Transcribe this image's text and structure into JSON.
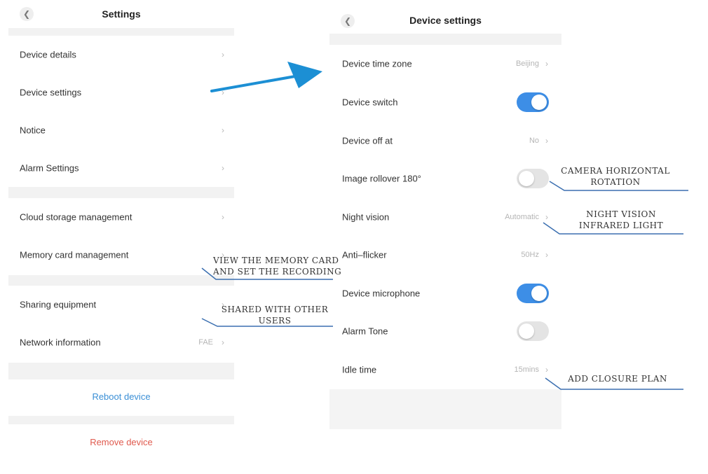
{
  "settings": {
    "title": "Settings",
    "items": [
      {
        "label": "Device details",
        "value": ""
      },
      {
        "label": "Device settings",
        "value": ""
      },
      {
        "label": "Notice",
        "value": ""
      },
      {
        "label": "Alarm Settings",
        "value": ""
      },
      {
        "label": "Cloud storage management",
        "value": ""
      },
      {
        "label": "Memory card management",
        "value": ""
      },
      {
        "label": "Sharing equipment",
        "value": ""
      },
      {
        "label": "Network information",
        "value": "FAE"
      }
    ],
    "reboot_label": "Reboot device",
    "remove_label": "Remove device"
  },
  "device_settings": {
    "title": "Device settings",
    "items": [
      {
        "label": "Device time zone",
        "value": "Beijing"
      },
      {
        "label": "Device switch",
        "toggle": true
      },
      {
        "label": "Device off at",
        "value": "No"
      },
      {
        "label": "Image rollover 180°",
        "toggle": false
      },
      {
        "label": "Night vision",
        "value": "Automatic"
      },
      {
        "label": "Anti–flicker",
        "value": "50Hz"
      },
      {
        "label": "Device microphone",
        "toggle": true
      },
      {
        "label": "Alarm Tone",
        "toggle": false
      },
      {
        "label": "Idle time",
        "value": "15mins"
      }
    ]
  },
  "annotations": {
    "memory_card": [
      "VIEW THE MEMORY CARD",
      "AND SET THE RECORDING"
    ],
    "sharing": [
      "SHARED WITH OTHER",
      "USERS"
    ],
    "rollover": [
      "CAMERA HORIZONTAL",
      "ROTATION"
    ],
    "night_vision": [
      "NIGHT VISION",
      "INFRARED LIGHT"
    ],
    "idle_time": [
      "ADD CLOSURE PLAN"
    ]
  },
  "icons": {
    "back": "chevron-left-icon",
    "chevron": "chevron-right-icon"
  },
  "colors": {
    "toggle_on": "#3d8ee6",
    "toggle_off": "#e4e4e4",
    "reboot": "#3a8fd6",
    "remove": "#e05a4e",
    "arrow": "#1c8fd4",
    "callout_line": "#3b6fb0"
  }
}
